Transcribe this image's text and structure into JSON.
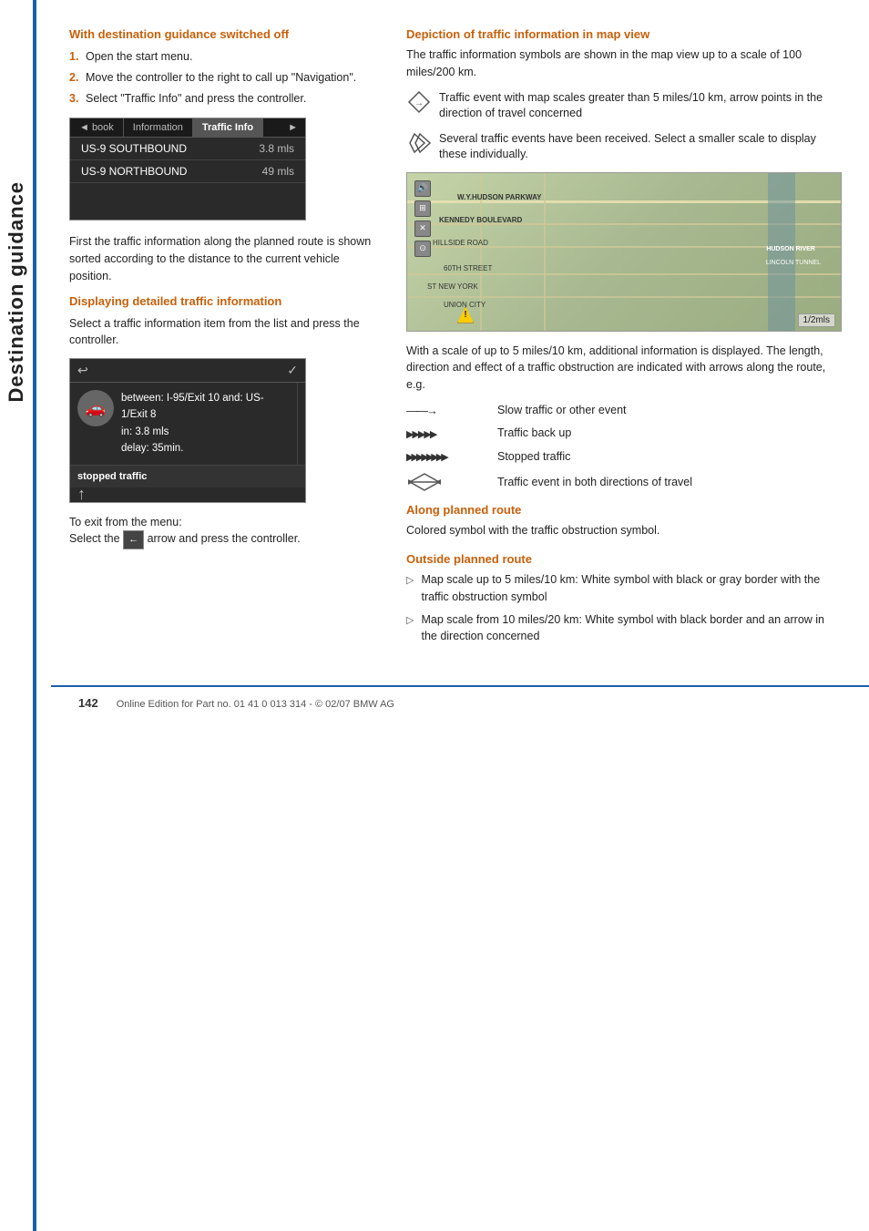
{
  "sidebar": {
    "label": "Destination guidance"
  },
  "left": {
    "section1_heading": "With destination guidance switched off",
    "steps": [
      {
        "num": "1.",
        "text": "Open the start menu."
      },
      {
        "num": "2.",
        "text": "Move the controller to the right to call up \"Navigation\"."
      },
      {
        "num": "3.",
        "text": "Select \"Traffic Info\" and press the controller."
      }
    ],
    "ui_tabs": [
      {
        "label": "◄ book",
        "active": false
      },
      {
        "label": "Information",
        "active": false
      },
      {
        "label": "Traffic Info",
        "active": true
      },
      {
        "label": "►",
        "active": false
      }
    ],
    "ui_routes": [
      {
        "name": "US-9 SOUTHBOUND",
        "dist": "3.8 mls"
      },
      {
        "name": "US-9 NORTHBOUND",
        "dist": "49 mls"
      }
    ],
    "after_ui_text": "First the traffic information along the planned route is shown sorted according to the distance to the current vehicle position.",
    "section2_heading": "Displaying detailed traffic information",
    "section2_intro": "Select a traffic information item from the list and press the controller.",
    "detail_between": "between: I-95/Exit 10 and: US-1/Exit 8",
    "detail_in": "in: 3.8 mls",
    "detail_delay": "delay: 35min.",
    "detail_event": "stopped traffic",
    "exit_text": "To exit from the menu:",
    "exit_instruction": "Select the",
    "exit_arrow_label": "←",
    "exit_instruction2": "arrow and press the controller."
  },
  "right": {
    "section1_heading": "Depiction of traffic information in map view",
    "section1_text": "The traffic information symbols are shown in the map view up to a scale of 100 miles/200 km.",
    "symbol1_text": "Traffic event with map scales greater than 5 miles/10 km, arrow points in the direction of travel concerned",
    "symbol2_text": "Several traffic events have been received. Select a smaller scale to display these individually.",
    "map_scale": "1/2mls",
    "map_labels": [
      "W.Y.HUDSON PARKWAY",
      "KENNEDY BOULEVARD",
      "HILLSIDE ROAD",
      "60TH STREET",
      "ST NEW YORK",
      "UNION CITY",
      "HUDSON RIVER",
      "LINCOLN TUNNEL"
    ],
    "after_map_text": "With a scale of up to 5 miles/10 km, additional information is displayed. The length, direction and effect of a traffic obstruction are indicated with arrows along the route, e.g.",
    "traffic_symbols": [
      {
        "arrows": "→→→",
        "label": "Slow traffic or other event"
      },
      {
        "arrows": "►►►►►",
        "label": "Traffic back up"
      },
      {
        "arrows": "▶▶▶▶▶▶▶▶",
        "label": "Stopped traffic"
      },
      {
        "arrows": "◆↔",
        "label": "Traffic event in both directions of travel"
      }
    ],
    "along_heading": "Along planned route",
    "along_text": "Colored symbol with the traffic obstruction symbol.",
    "outside_heading": "Outside planned route",
    "outside_items": [
      {
        "bullet": "▷",
        "text": "Map scale up to 5 miles/10 km: White symbol with black or gray border with the traffic obstruction symbol"
      },
      {
        "bullet": "▷",
        "text": "Map scale from 10 miles/20 km: White symbol with black border and an arrow in the direction concerned"
      }
    ]
  },
  "footer": {
    "page_number": "142",
    "copyright": "Online Edition for Part no. 01 41 0 013 314 - © 02/07 BMW AG"
  }
}
